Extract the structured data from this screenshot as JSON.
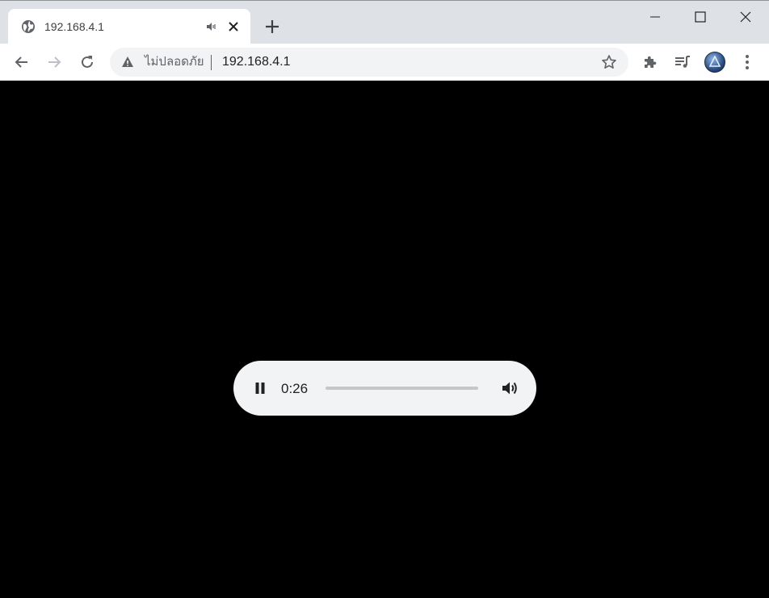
{
  "tab": {
    "title": "192.168.4.1",
    "favicon_icon": "globe-icon",
    "audio_icon": "speaker-icon",
    "close_icon": "close-icon"
  },
  "tabstrip": {
    "new_tab_icon": "plus-icon"
  },
  "window_controls": [
    "minimize-icon",
    "maximize-icon",
    "close-icon"
  ],
  "toolbar": {
    "back_icon": "back-arrow-icon",
    "forward_icon": "forward-arrow-icon",
    "reload_icon": "reload-icon",
    "omnibox": {
      "security_label": "ไม่ปลอดภัย",
      "url": "192.168.4.1",
      "warning_icon": "warning-icon",
      "bookmark_icon": "star-icon"
    },
    "extensions_icon": "puzzle-icon",
    "media_icon": "media-queue-icon",
    "profile_icon": "avatar",
    "menu_icon": "kebab-menu-icon"
  },
  "player": {
    "state": "playing",
    "time": "0:26",
    "progress": 0.0,
    "play_icon": "pause-icon",
    "volume_icon": "volume-icon"
  },
  "colors": {
    "tabstrip_bg": "#dee1e6",
    "toolbar_bg": "#ffffff",
    "omnibox_bg": "#f1f3f4",
    "content_bg": "#000000",
    "player_bg": "#f1f3f4",
    "icon": "#5f6368"
  }
}
